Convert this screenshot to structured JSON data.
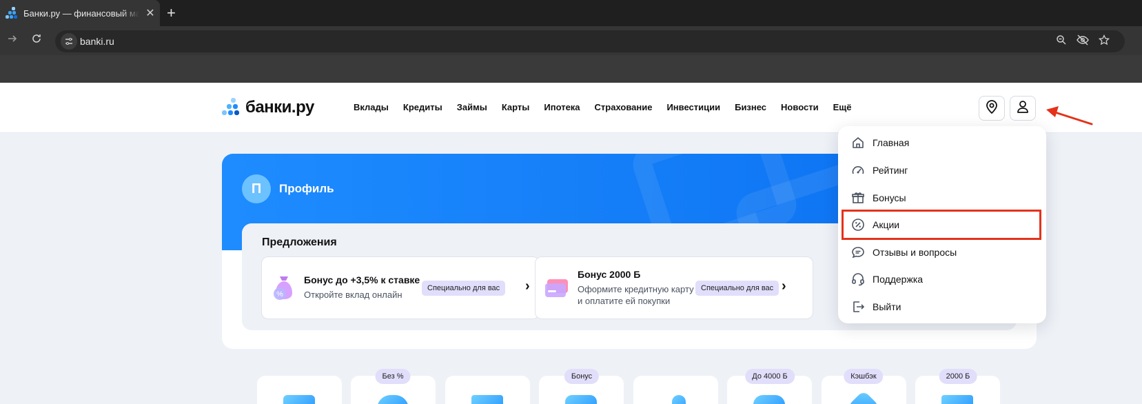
{
  "browser": {
    "tab_title": "Банки.ру — финансовый маркетплейс",
    "tab_close": "✕",
    "new_tab": "+",
    "url": "banki.ru"
  },
  "header": {
    "logo_text": "банки.ру",
    "menu": [
      "Вклады",
      "Кредиты",
      "Займы",
      "Карты",
      "Ипотека",
      "Страхование",
      "Инвестиции",
      "Бизнес",
      "Новости",
      "Ещё"
    ]
  },
  "profile": {
    "avatar_letter": "П",
    "name": "Профиль",
    "offers_title": "Предложения",
    "offers": [
      {
        "title": "Бонус до +3,5% к ставке",
        "subtitle": "Откройте вклад онлайн",
        "badge": "Специально для вас",
        "icon": "money-bag-icon"
      },
      {
        "title": "Бонус 2000 Б",
        "subtitle_1": "Оформите кредитную карту",
        "subtitle_2": "и оплатите ей покупки",
        "badge": "Специально для вас",
        "icon": "credit-card-icon"
      }
    ]
  },
  "dropdown": {
    "items": [
      {
        "label": "Главная",
        "icon": "home-icon"
      },
      {
        "label": "Рейтинг",
        "icon": "speedometer-icon"
      },
      {
        "label": "Бонусы",
        "icon": "gift-icon"
      },
      {
        "label": "Акции",
        "icon": "percent-icon",
        "highlighted": true
      },
      {
        "label": "Отзывы и вопросы",
        "icon": "chat-icon"
      },
      {
        "label": "Поддержка",
        "icon": "headset-icon"
      },
      {
        "label": "Выйти",
        "icon": "logout-icon"
      }
    ]
  },
  "tiles": {
    "badges": [
      "Без %",
      "Бонус",
      "До 4000 Б",
      "Кэшбэк",
      "2000 Б"
    ]
  },
  "colors": {
    "accent": "#1e8cff",
    "highlight": "#e4321b",
    "badge_bg": "#e1defb"
  }
}
